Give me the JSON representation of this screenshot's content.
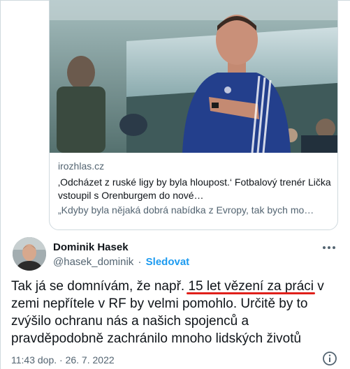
{
  "card": {
    "domain": "irozhlas.cz",
    "title": "‚Odcházet z ruské ligy by byla hloupost.‘ Fotbalový trenér Lička vstoupil s Orenburgem do nové…",
    "description": "„Kdyby byla nějaká dobrá nabídka z Evropy, tak bych mo…"
  },
  "author": {
    "name": "Dominik Hasek",
    "handle": "@hasek_dominik",
    "separator": "·",
    "follow_label": "Sledovat"
  },
  "tweet": {
    "text_before": "Tak já se domnívám, že např. ",
    "text_highlight": "15 let vězení za práci",
    "text_after": " v zemi nepřítele v RF by velmi pomohlo.  Určitě by to zvýšilo ochranu nás a našich spojenců a pravděpodobně zachránilo mnoho lidských životů"
  },
  "meta": {
    "timestamp": "11:43 dop. · 26. 7. 2022"
  },
  "icons": {
    "more": "more-icon",
    "info": "info-icon"
  },
  "colors": {
    "accent": "#1d9bf0",
    "underline": "#e0201a",
    "secondary_text": "#536471",
    "border": "#cfd9de"
  }
}
